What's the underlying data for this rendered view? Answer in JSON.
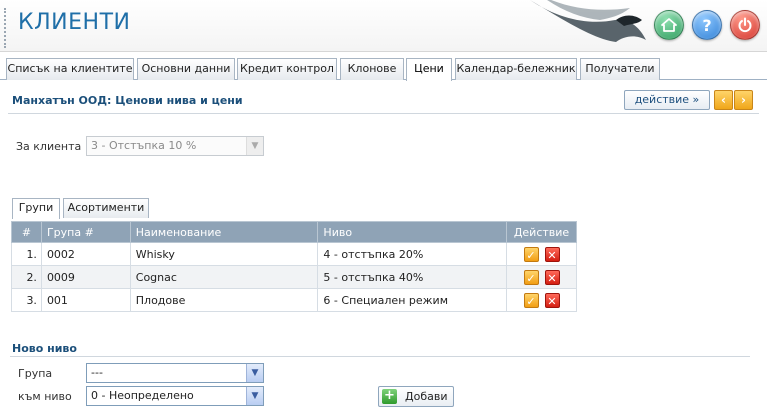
{
  "app": {
    "title": "КЛИЕНТИ"
  },
  "header_buttons": {
    "home": "home-icon",
    "help": "?",
    "power": "power-icon"
  },
  "tabs": [
    {
      "label": "Списък на клиентите",
      "active": false
    },
    {
      "label": "Основни данни",
      "active": false
    },
    {
      "label": "Кредит контрол",
      "active": false
    },
    {
      "label": "Клонове",
      "active": false
    },
    {
      "label": "Цени",
      "active": true
    },
    {
      "label": "Календар-бележник",
      "active": false
    },
    {
      "label": "Получатели",
      "active": false
    }
  ],
  "section": {
    "title": "Манхатън ООД: Ценови нива и цени",
    "action_label": "действие »",
    "prev": "‹",
    "next": "›"
  },
  "client_level": {
    "label": "За клиента",
    "value": "3 - Отстъпка 10 %"
  },
  "inner_tabs": [
    {
      "label": "Групи",
      "active": true
    },
    {
      "label": "Асортименти",
      "active": false
    }
  ],
  "table": {
    "headers": [
      "#",
      "Група #",
      "Наименование",
      "Ниво",
      "Действие"
    ],
    "rows": [
      {
        "num": "1.",
        "group": "0002",
        "name": "Whisky",
        "level": "4 - отстъпка 20%"
      },
      {
        "num": "2.",
        "group": "0009",
        "name": "Cognac",
        "level": "5 - отстъпка 40%"
      },
      {
        "num": "3.",
        "group": "001",
        "name": "Плодове",
        "level": "6 - Специален режим"
      }
    ]
  },
  "new_level": {
    "title": "Ново ниво",
    "group_label": "Група",
    "group_value": "---",
    "level_label": "към ниво",
    "level_value": "0 - Неопределено",
    "add_label": "Добави"
  },
  "colors": {
    "accent": "#1f6fa8",
    "header_row": "#8fa3b6",
    "edit": "#f29e14",
    "delete": "#d41e12"
  }
}
